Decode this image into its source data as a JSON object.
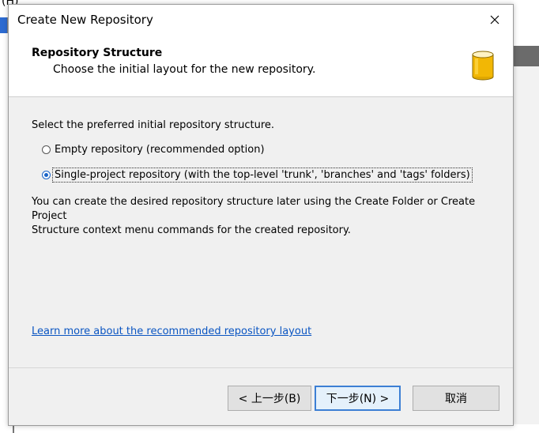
{
  "background": {
    "top_fragment": "(H)"
  },
  "dialog": {
    "title": "Create New Repository",
    "header": {
      "title": "Repository Structure",
      "subtitle": "Choose the initial layout for the new repository.",
      "icon": "database-cylinder-icon"
    },
    "prompt": "Select the preferred initial repository structure.",
    "options": [
      {
        "label": "Empty repository (recommended option)",
        "checked": false
      },
      {
        "label": "Single-project repository (with the top-level 'trunk', 'branches' and 'tags' folders)",
        "checked": true
      }
    ],
    "description_line1": "You can create the desired repository structure later using the Create Folder or Create Project",
    "description_line2": "Structure context menu commands for the created repository.",
    "link": "Learn more about the recommended repository layout",
    "buttons": {
      "back": "< 上一步(B)",
      "next": "下一步(N) >",
      "cancel": "取消"
    }
  },
  "colors": {
    "dialog_bg": "#f0f0f0",
    "link": "#0a55c2",
    "accent": "#1a64c8",
    "icon_gold": "#f2b705"
  }
}
